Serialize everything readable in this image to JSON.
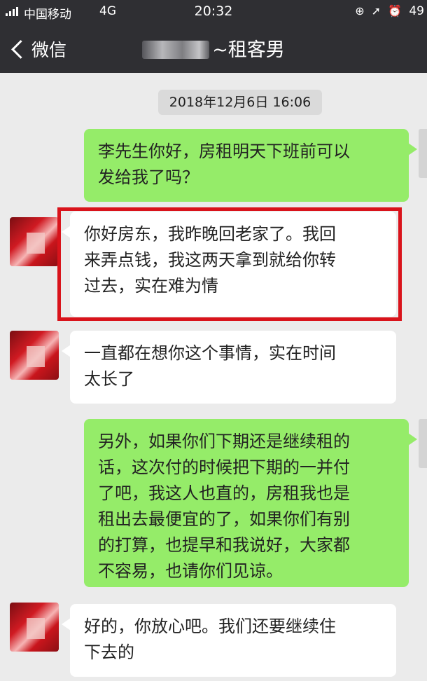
{
  "status_bar": {
    "carrier": "中国移动",
    "network": "4G",
    "time": "20:32",
    "battery": "49",
    "icons": [
      "alarm-lock-icon",
      "location-arrow-icon",
      "alarm-clock-icon"
    ]
  },
  "nav": {
    "back_label": "微信",
    "title": "~租客男"
  },
  "chat": {
    "timestamp": "2018年12月6日 16:06",
    "messages": [
      {
        "side": "right",
        "text": "李先生你好，房租明天下班前可以\n发给我了吗？"
      },
      {
        "side": "left",
        "text": "你好房东，我昨晚回老家了。我回\n来弄点钱，我这两天拿到就给你转\n过去，实在难为情",
        "highlighted": true
      },
      {
        "side": "left",
        "text": "一直都在想你这个事情，实在时间\n太长了"
      },
      {
        "side": "right",
        "text": "另外，如果你们下期还是继续租的\n话，这次付的时候把下期的一并付\n了吧，我这人也直的，房租我也是\n租出去最便宜的了，如果你们有别\n的打算，也提早和我说好，大家都\n不容易，也请你们见谅。"
      },
      {
        "side": "left",
        "text": "好的，你放心吧。我们还要继续住\n下去的"
      }
    ]
  },
  "colors": {
    "nav_bar": "#2f2f33",
    "chat_background": "#ebebeb",
    "sent_bubble": "#95ec69",
    "received_bubble": "#ffffff",
    "highlight_border": "#d9131b"
  }
}
